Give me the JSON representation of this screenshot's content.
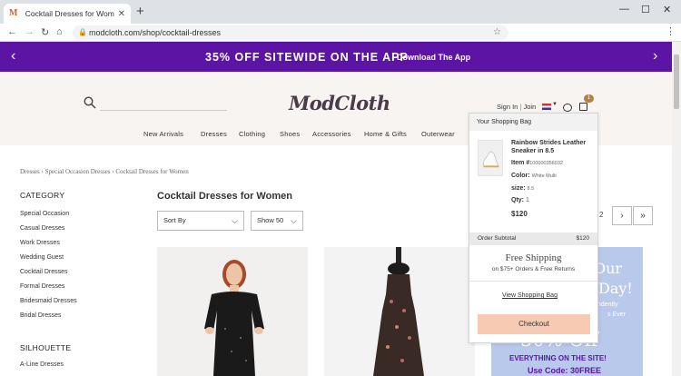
{
  "browser": {
    "tab_title": "Cocktail Dresses for Women | M",
    "tab_favicon": "M",
    "url": "modcloth.com/shop/cocktail-dresses"
  },
  "promo": {
    "message": "35% OFF SITEWIDE ON THE APP",
    "cta": "Download The App"
  },
  "header": {
    "logo": "ModCloth",
    "sign_in": "Sign In",
    "join": "Join",
    "bag_count": "1",
    "nav": [
      "New Arrivals",
      "Dresses",
      "Clothing",
      "Shoes",
      "Accessories",
      "Home & Gifts",
      "Outerwear"
    ]
  },
  "breadcrumb": "Dresses › Special Occasion Dresses › Cocktail Dresses for Women",
  "sidebar": {
    "category_heading": "CATEGORY",
    "categories": [
      "Special Occasion",
      "Casual Dresses",
      "Work Dresses",
      "Wedding Guest",
      "Cocktail Dresses",
      "Formal Dresses",
      "Bridesmaid Dresses",
      "Bridal Dresses"
    ],
    "silhouette_heading": "SILHOUETTE",
    "silhouettes": [
      "A-Line Dresses"
    ]
  },
  "main": {
    "title": "Cocktail Dresses for Women",
    "sort_label": "Sort By",
    "show_label": "Show 50",
    "page_num": "2",
    "next_icon": "›",
    "last_icon": "»"
  },
  "ad": {
    "line1": "Our",
    "line2": "Day!",
    "line3": "endently",
    "line4": "s Ever",
    "line5": "30% Off",
    "line6": "EVERYTHING ON THE SITE!",
    "line7": "Use Code: 30FREE"
  },
  "bag": {
    "heading": "Your Shopping Bag",
    "item_name": "Rainbow Strides Leather Sneaker in 8.5",
    "item_label": "Item #",
    "item_number": "100000356032",
    "color_label": "Color:",
    "color_value": "White Multi",
    "size_label": "size:",
    "size_value": "8.5",
    "qty_label": "Qty:",
    "qty_value": "1",
    "price": "$120",
    "subtotal_label": "Order Subtotal",
    "subtotal_value": "$120",
    "free_shipping": "Free Shipping",
    "free_shipping_sub": "on $75+ Orders & Free Returns",
    "view_bag": "View Shopping Bag",
    "checkout": "Checkout"
  },
  "icons": {
    "search": "search-icon",
    "chat": "chat-icon",
    "bag": "shopping-bag-icon",
    "flag": "us-flag-icon"
  },
  "colors": {
    "promo_bg": "#5b14a4",
    "header_bg": "#f7f4f1",
    "checkout_bg": "#f7cab3",
    "ad_bg": "#b9c9ec"
  }
}
